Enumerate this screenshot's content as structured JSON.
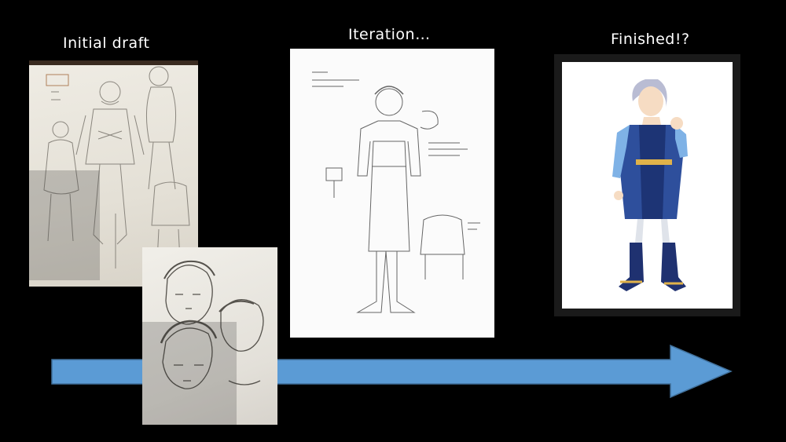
{
  "labels": {
    "initial": "Initial draft",
    "iteration": "Iteration…",
    "finished": "Finished!?"
  },
  "colors": {
    "background": "#000000",
    "arrow": "#5b9bd5",
    "text": "#ffffff"
  },
  "icons": {
    "arrow": "right-arrow-icon"
  }
}
